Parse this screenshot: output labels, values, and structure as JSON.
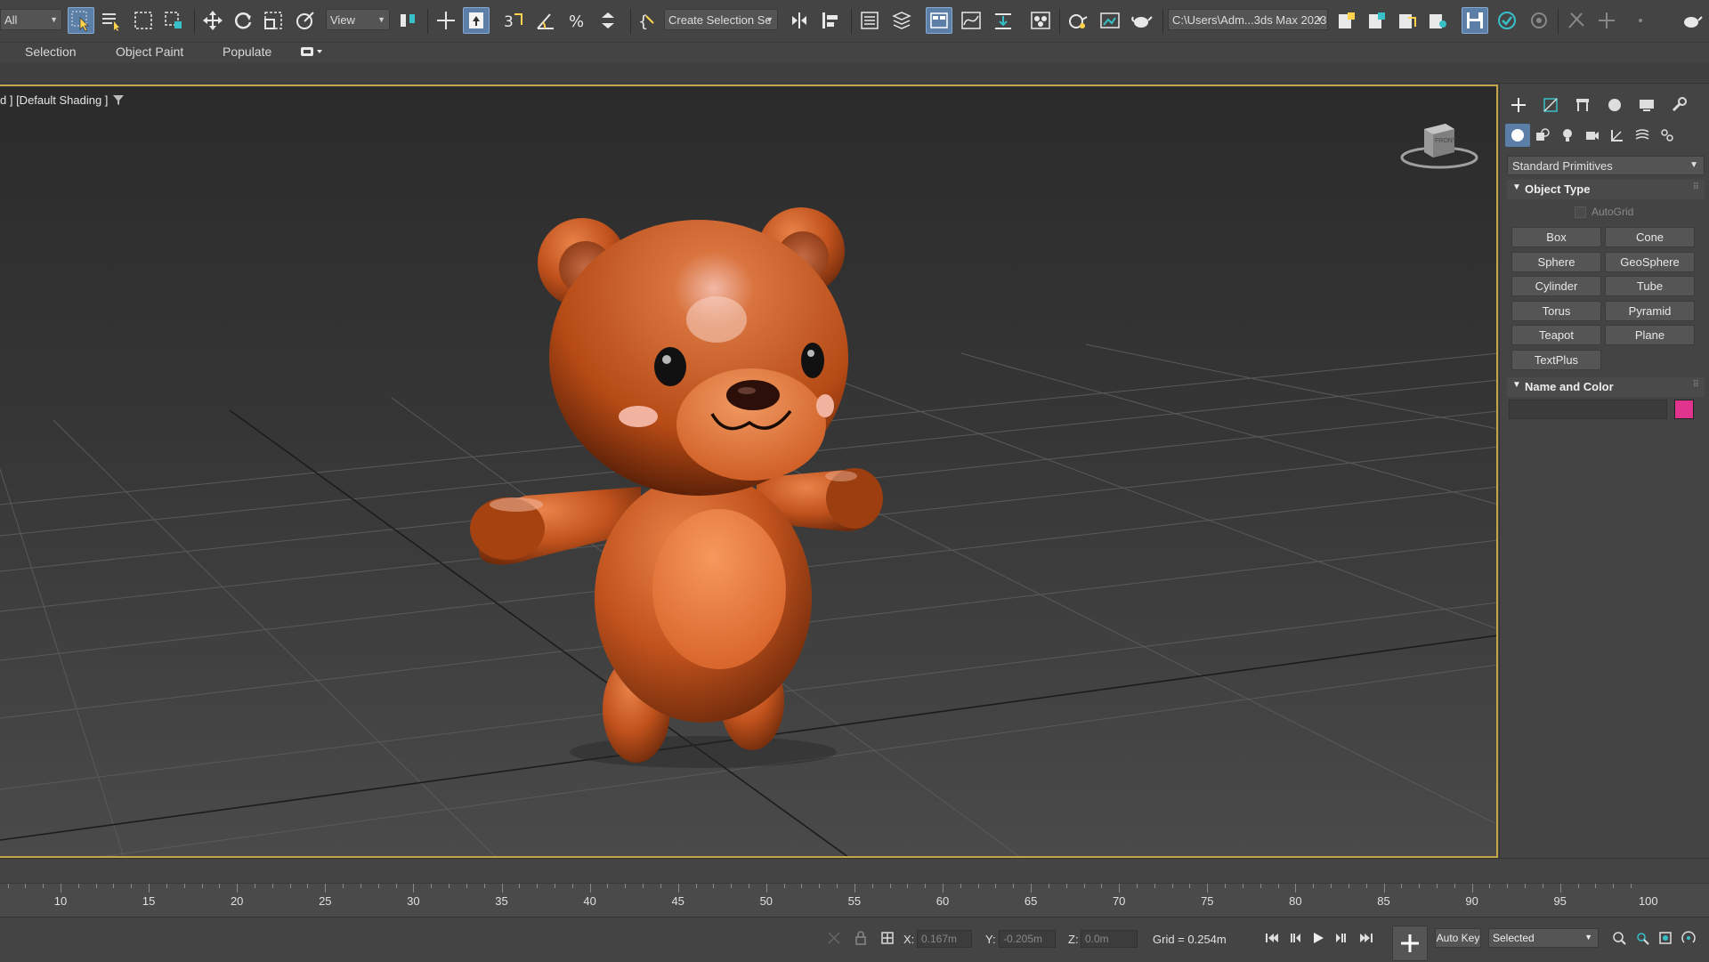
{
  "toolbar": {
    "selection_filter": "All",
    "ref_coord": "View",
    "named_selection": "Create Selection Se",
    "project_path": "C:\\Users\\Adm...3ds Max 2023"
  },
  "ribbon": {
    "tabs": [
      "Selection",
      "Object Paint",
      "Populate"
    ]
  },
  "viewport": {
    "label": "d ] [Default Shading ]",
    "viewcube_label": "FRONT"
  },
  "command_panel": {
    "category": "Standard Primitives",
    "object_type_title": "Object Type",
    "autogrid_label": "AutoGrid",
    "object_buttons": [
      "Box",
      "Cone",
      "Sphere",
      "GeoSphere",
      "Cylinder",
      "Tube",
      "Torus",
      "Pyramid",
      "Teapot",
      "Plane",
      "TextPlus"
    ],
    "name_color_title": "Name and Color",
    "object_color": "#e0348e"
  },
  "timeline": {
    "ticks": [
      "10",
      "15",
      "20",
      "25",
      "30",
      "35",
      "40",
      "45",
      "50",
      "55",
      "60",
      "65",
      "70",
      "75",
      "80",
      "85",
      "90",
      "95",
      "100"
    ]
  },
  "status": {
    "x_label": "X:",
    "x_value": "0.167m",
    "y_label": "Y:",
    "y_value": "-0.205m",
    "z_label": "Z:",
    "z_value": "0.0m",
    "grid": "Grid = 0.254m",
    "auto_key": "Auto Key",
    "key_mode": "Selected"
  }
}
